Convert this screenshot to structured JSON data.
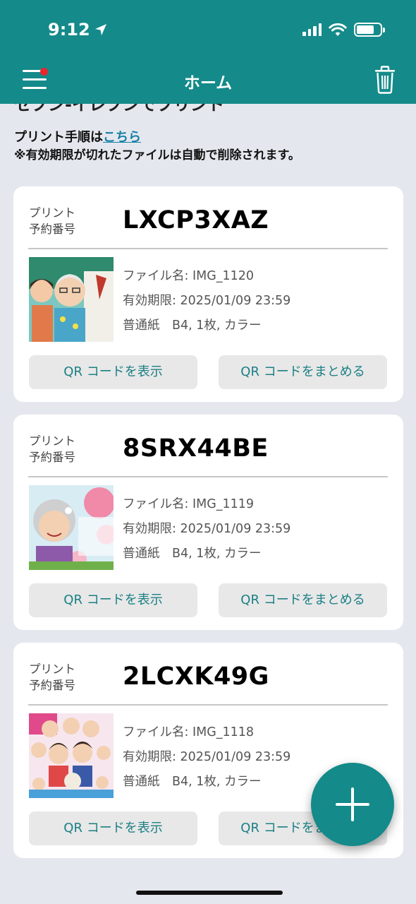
{
  "status_bar": {
    "time": "9:12"
  },
  "header": {
    "title": "ホーム"
  },
  "intro": {
    "title": "セブン-イレブンでプリント",
    "procedure_prefix": "プリント手順は",
    "procedure_link": "こちら",
    "note": "※有効期限が切れたファイルは自動で削除されます。"
  },
  "cards": [
    {
      "reservation_label_1": "プリント",
      "reservation_label_2": "予約番号",
      "code": "LXCP3XAZ",
      "file_name": "ファイル名:  IMG_1120",
      "expiry": "有効期限:  2025/01/09 23:59",
      "paper": "普通紙　B4, 1枚, カラー",
      "show_qr": "QR コードを表示",
      "merge_qr": "QR コードをまとめる"
    },
    {
      "reservation_label_1": "プリント",
      "reservation_label_2": "予約番号",
      "code": "8SRX44BE",
      "file_name": "ファイル名:  IMG_1119",
      "expiry": "有効期限:  2025/01/09 23:59",
      "paper": "普通紙　B4, 1枚, カラー",
      "show_qr": "QR コードを表示",
      "merge_qr": "QR コードをまとめる"
    },
    {
      "reservation_label_1": "プリント",
      "reservation_label_2": "予約番号",
      "code": "2LCXK49G",
      "file_name": "ファイル名:  IMG_1118",
      "expiry": "有効期限:  2025/01/09 23:59",
      "paper": "普通紙　B4, 1枚, カラー",
      "show_qr": "QR コードを表示",
      "merge_qr": "QR コードをまとめる"
    }
  ],
  "colors": {
    "header": "#148a8a",
    "background": "#e4e8ee",
    "link": "#1680a6",
    "button_text": "#1b7f84",
    "notification_dot": "#e8262c"
  },
  "icons": [
    "menu-icon",
    "trash-icon",
    "location-arrow-icon",
    "signal-icon",
    "wifi-icon",
    "battery-icon",
    "plus-icon"
  ]
}
